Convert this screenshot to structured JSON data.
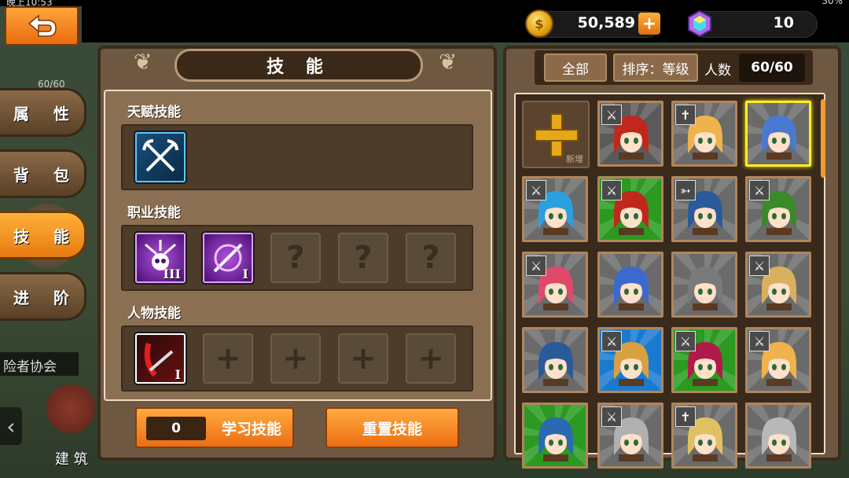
{
  "status": {
    "time": "晚上10:53",
    "battery": "30%"
  },
  "resources": {
    "gold": "50,589",
    "gold_plus": "+",
    "gems": "10"
  },
  "left_tabs": [
    {
      "label": "属 性",
      "active": false
    },
    {
      "label": "背 包",
      "active": false
    },
    {
      "label": "技 能",
      "active": true
    },
    {
      "label": "进 阶",
      "active": false
    }
  ],
  "left_background": {
    "stat": "60/60",
    "guild": "险者协会",
    "building": "建 筑",
    "arrow": "‹"
  },
  "skill_panel": {
    "title": "技 能",
    "talent_label": "天赋技能",
    "job_label": "职业技能",
    "character_label": "人物技能",
    "talent_icon": "crossed-pickaxes-icon",
    "job_skills": [
      {
        "icon": "skull-arrows-icon",
        "level": "III"
      },
      {
        "icon": "slash-strike-icon",
        "level": "I"
      }
    ],
    "character_skills": [
      {
        "icon": "blood-sword-icon",
        "level": "I"
      }
    ],
    "locked_symbol": "?",
    "empty_symbol": "+",
    "learn_count": "0",
    "learn_label": "学习技能",
    "reset_label": "重置技能"
  },
  "hero_panel": {
    "filter_all": "全部",
    "filter_sort": "排序：等级",
    "count_label": "人数",
    "count_value": "60/60",
    "add_label": "新增",
    "heroes": [
      {
        "class": "sword",
        "bg": "#5a5a5a",
        "hair": "#c0281c",
        "selected": false
      },
      {
        "class": "cross",
        "bg": "#6a6a6a",
        "hair": "#f0b24a",
        "selected": false
      },
      {
        "class": "",
        "bg": "#6a6a6a",
        "hair": "#4a7ad0",
        "selected": true
      },
      {
        "class": "sword",
        "bg": "#6a6a6a",
        "hair": "#2aa0e0",
        "selected": false
      },
      {
        "class": "sword",
        "bg": "#2a9a20",
        "hair": "#c0281c",
        "selected": false
      },
      {
        "class": "bow",
        "bg": "#6a6a6a",
        "hair": "#2a5a9a",
        "selected": false
      },
      {
        "class": "sword",
        "bg": "#6a6a6a",
        "hair": "#3a8a2a",
        "selected": false
      },
      {
        "class": "sword",
        "bg": "#6a6a6a",
        "hair": "#e04a6a",
        "selected": false
      },
      {
        "class": "",
        "bg": "#6a6a6a",
        "hair": "#3a6ad0",
        "selected": false
      },
      {
        "class": "",
        "bg": "#6a6a6a",
        "hair": "#7a7a7a",
        "selected": false
      },
      {
        "class": "sword",
        "bg": "#6a6a6a",
        "hair": "#d8b060",
        "selected": false
      },
      {
        "class": "",
        "bg": "#6a6a6a",
        "hair": "#2a5a9a",
        "selected": false
      },
      {
        "class": "sword",
        "bg": "#1a7ad0",
        "hair": "#d8a040",
        "selected": false
      },
      {
        "class": "sword",
        "bg": "#2a9a20",
        "hair": "#b01a4a",
        "selected": false
      },
      {
        "class": "sword",
        "bg": "#6a6a6a",
        "hair": "#f0b24a",
        "selected": false
      },
      {
        "class": "",
        "bg": "#2a9a20",
        "hair": "#2a6ab0",
        "selected": false
      },
      {
        "class": "sword",
        "bg": "#6a6a6a",
        "hair": "#b0b0b0",
        "selected": false
      },
      {
        "class": "cross",
        "bg": "#6a6a6a",
        "hair": "#e0c060",
        "selected": false
      },
      {
        "class": "",
        "bg": "#6a6a6a",
        "hair": "#b8b8b8",
        "selected": false
      }
    ]
  },
  "colors": {
    "accent": "#f08a20",
    "panel": "#6e5842",
    "selected_border": "#ffee20"
  }
}
